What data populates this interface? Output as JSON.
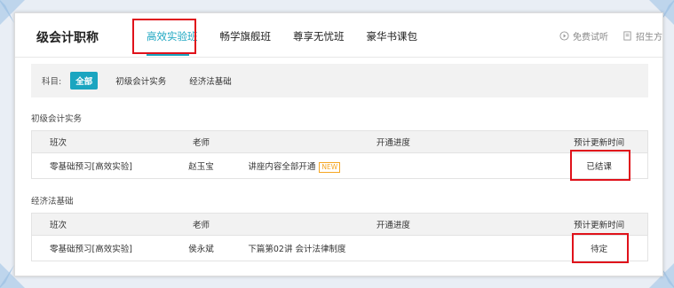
{
  "header": {
    "title": "级会计职称",
    "tabs": [
      {
        "label": "高效实验班",
        "active": true
      },
      {
        "label": "畅学旗舰班",
        "active": false
      },
      {
        "label": "尊享无忧班",
        "active": false
      },
      {
        "label": "豪华书课包",
        "active": false
      }
    ],
    "actions": [
      {
        "label": "免费试听",
        "icon": "play-circle-icon"
      },
      {
        "label": "招生方",
        "icon": "document-icon"
      }
    ]
  },
  "filter": {
    "label": "科目:",
    "options": [
      {
        "label": "全部",
        "active": true
      },
      {
        "label": "初级会计实务",
        "active": false
      },
      {
        "label": "经济法基础",
        "active": false
      }
    ]
  },
  "sections": [
    {
      "title": "初级会计实务",
      "columns": [
        "班次",
        "老师",
        "开通进度",
        "预计更新时间"
      ],
      "rows": [
        {
          "class": "零基础预习[高效实验]",
          "teacher": "赵玉宝",
          "progress": "讲座内容全部开通",
          "badge": "NEW",
          "update": "已结课"
        }
      ]
    },
    {
      "title": "经济法基础",
      "columns": [
        "班次",
        "老师",
        "开通进度",
        "预计更新时间"
      ],
      "rows": [
        {
          "class": "零基础预习[高效实验]",
          "teacher": "侯永斌",
          "progress": "下篇第02讲  会计法律制度",
          "badge": "",
          "update": "待定"
        }
      ]
    }
  ],
  "colors": {
    "accent": "#1aa5c0",
    "highlight": "#e0121b",
    "badge": "#f5a623"
  }
}
